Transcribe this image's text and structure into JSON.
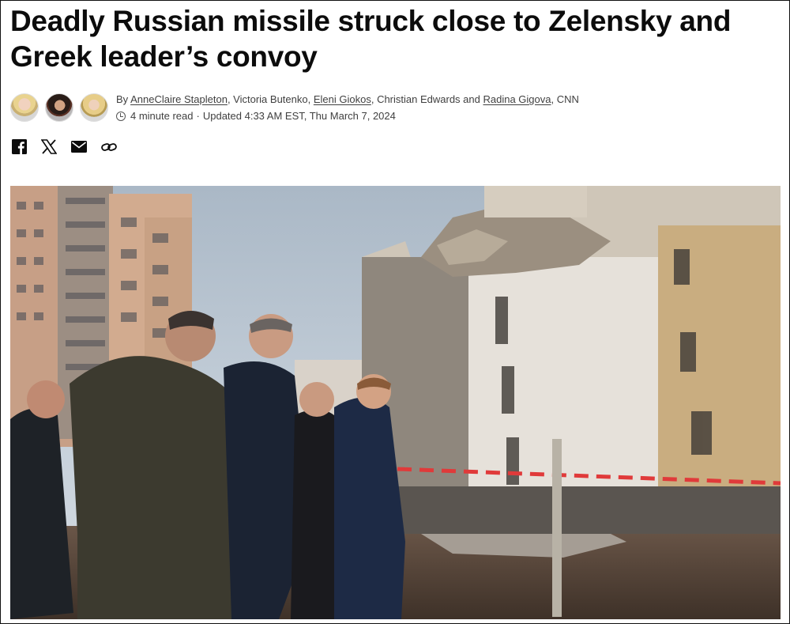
{
  "article": {
    "headline": "Deadly Russian missile struck close to Zelensky and Greek leader’s convoy",
    "byline": {
      "prefix": "By",
      "authors": [
        {
          "name": "AnneClaire Stapleton",
          "linked": true
        },
        {
          "name": "Victoria Butenko",
          "linked": false
        },
        {
          "name": "Eleni Giokos",
          "linked": true
        },
        {
          "name": "Christian Edwards",
          "linked": false
        },
        {
          "name": "Radina Gigova",
          "linked": true
        }
      ],
      "sep1": ", ",
      "sep2": ", ",
      "sep3": ", ",
      "and": " and ",
      "suffix": ", CNN"
    },
    "read_time": "4 minute read",
    "dot": "·",
    "updated": "Updated 4:33 AM EST, Thu March 7, 2024"
  },
  "share": {
    "icons": [
      "facebook-icon",
      "x-icon",
      "email-icon",
      "link-icon"
    ]
  },
  "colors": {
    "text": "#0c0c0c",
    "meta": "#404040",
    "sky": "#b9c6d3"
  }
}
